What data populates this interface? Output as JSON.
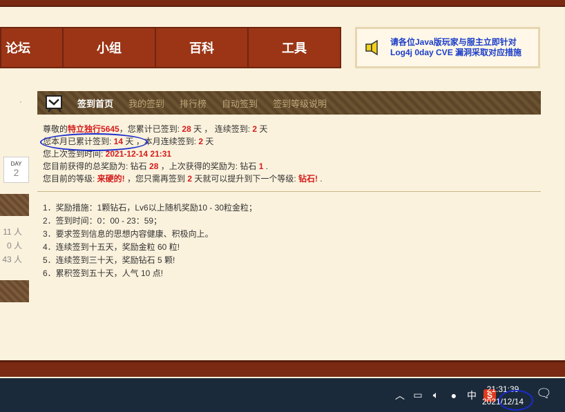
{
  "nav": {
    "items": [
      {
        "label": "论坛"
      },
      {
        "label": "小组"
      },
      {
        "label": "百科"
      },
      {
        "label": "工具"
      }
    ]
  },
  "notice": {
    "text": "请各位Java版玩家与服主立即针对Log4j 0day CVE 漏洞采取对应措施",
    "icon": "speaker-icon"
  },
  "sidebar": {
    "day_label": "DAY",
    "day_value": "2",
    "stats": [
      "11 人",
      "0 人",
      "43 人"
    ]
  },
  "tabs": [
    {
      "label": "签到首页",
      "active": true
    },
    {
      "label": "我的签到",
      "active": false
    },
    {
      "label": "排行榜",
      "active": false
    },
    {
      "label": "自动签到",
      "active": false
    },
    {
      "label": "签到等级说明",
      "active": false
    }
  ],
  "info": {
    "l1_pre": "尊敬的",
    "username": "特立独行5645",
    "l1_mid": "，您累计已签到: ",
    "total_days": "28",
    "l1_mid2": " 天 ， 连续签到: ",
    "streak": "2",
    "l1_end": " 天",
    "l2_pre": "您本月已累计签到: ",
    "month_days": "14",
    "l2_mid": " 天 ，本月连续签到: ",
    "month_streak": "2",
    "l2_end": " 天",
    "l3_pre": "您上次签到时间: ",
    "last_time": "2021-12-14 21:31",
    "l4_pre": "您目前获得的总奖励为: 钻石 ",
    "total_reward": "28",
    "l4_mid": " ，上次获得的奖励为: 钻石 ",
    "last_reward": "1",
    "l4_end": " .",
    "l5_pre": "您目前的等级: ",
    "level": "来硬的!",
    "l5_mid": " ，您只需再签到 ",
    "need_days": "2",
    "l5_mid2": " 天就可以提升到下一个等级: ",
    "next_level": "钻石!",
    "l5_end": " ."
  },
  "rules": [
    "1．奖励措施：1颗钻石，Lv6以上随机奖励10 - 30粒金粒；",
    "2．签到时间：0：00 - 23：59；",
    "3．要求签到信息的思想内容健康、积极向上。",
    "4．连续签到十五天，奖励金粒 60 粒!",
    "5．连续签到三十天，奖励钻石 5 颗!",
    "6．累积签到五十天，人气 10 点!"
  ],
  "taskbar": {
    "time": "21:31:39",
    "date": "2021/12/14",
    "ime": "中",
    "sogou": "S"
  }
}
